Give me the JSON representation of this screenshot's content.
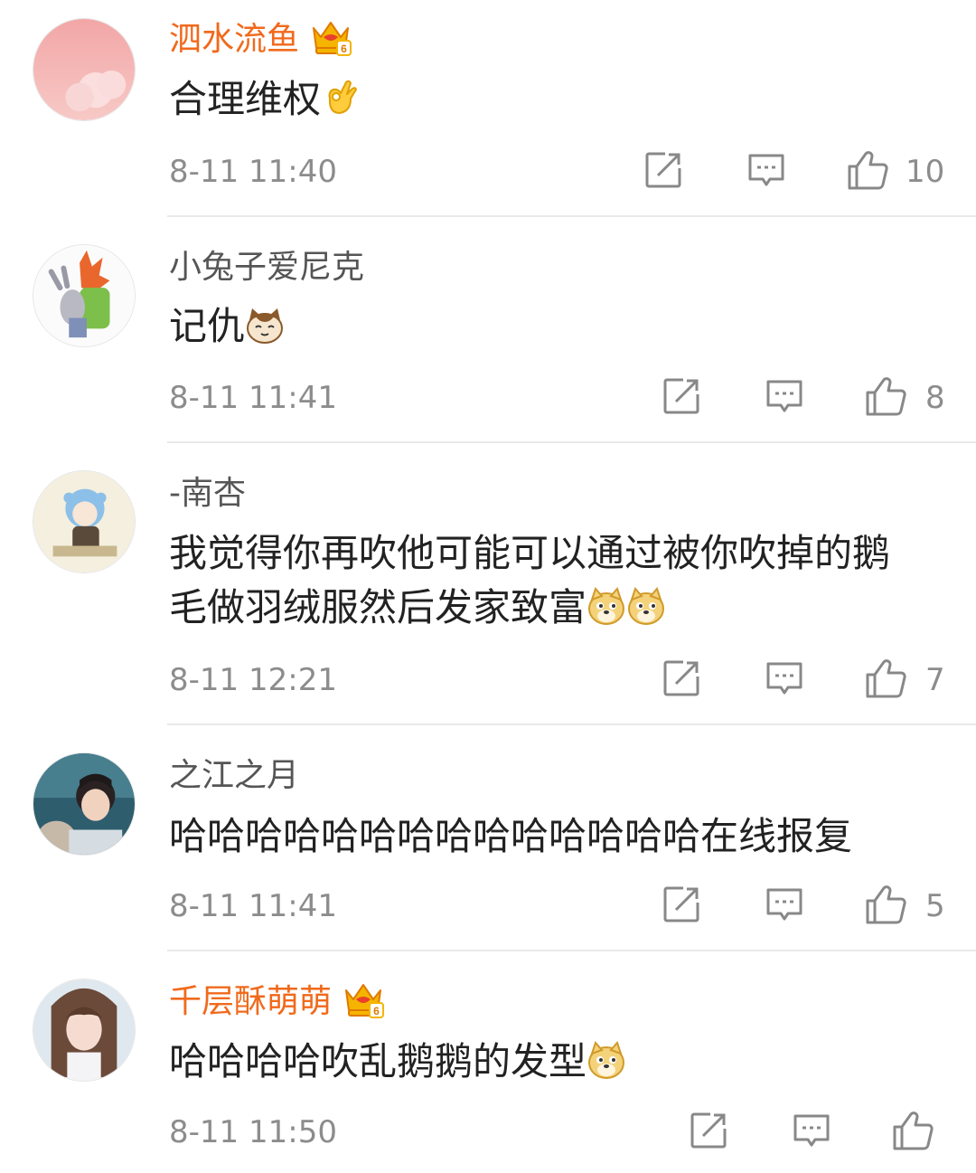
{
  "comments": [
    {
      "username": "泗水流鱼",
      "vip": true,
      "text": "合理维权",
      "emoji": [
        "ok-hand-emoji"
      ],
      "time": "8-11 11:40",
      "likes": "10"
    },
    {
      "username": "小兔子爱尼克",
      "vip": false,
      "text": "记仇",
      "emoji": [
        "cat-emoji"
      ],
      "time": "8-11 11:41",
      "likes": "8"
    },
    {
      "username": "-南杏",
      "vip": false,
      "text_line1": "我觉得你再吹他可能可以通过被你吹掉的鹅",
      "text_line2": "毛做羽绒服然后发家致富",
      "emoji": [
        "doge-emoji",
        "doge-emoji"
      ],
      "time": "8-11 12:21",
      "likes": "7"
    },
    {
      "username": "之江之月",
      "vip": false,
      "text": "哈哈哈哈哈哈哈哈哈哈哈哈哈哈在线报复",
      "emoji": [],
      "time": "8-11 11:41",
      "likes": "5"
    },
    {
      "username": "千层酥萌萌",
      "vip": true,
      "text": "哈哈哈哈吹乱鹅鹅的发型",
      "emoji": [
        "doge-emoji"
      ],
      "time": "8-11 11:50",
      "likes": ""
    }
  ],
  "vip_badge": {
    "level": "6",
    "icon": "crown-icon"
  },
  "colors": {
    "vip_name": "#f06a1c",
    "normal_name": "#555555",
    "text": "#222222",
    "meta": "#8c8c8c",
    "divider": "#e9e9e9"
  }
}
